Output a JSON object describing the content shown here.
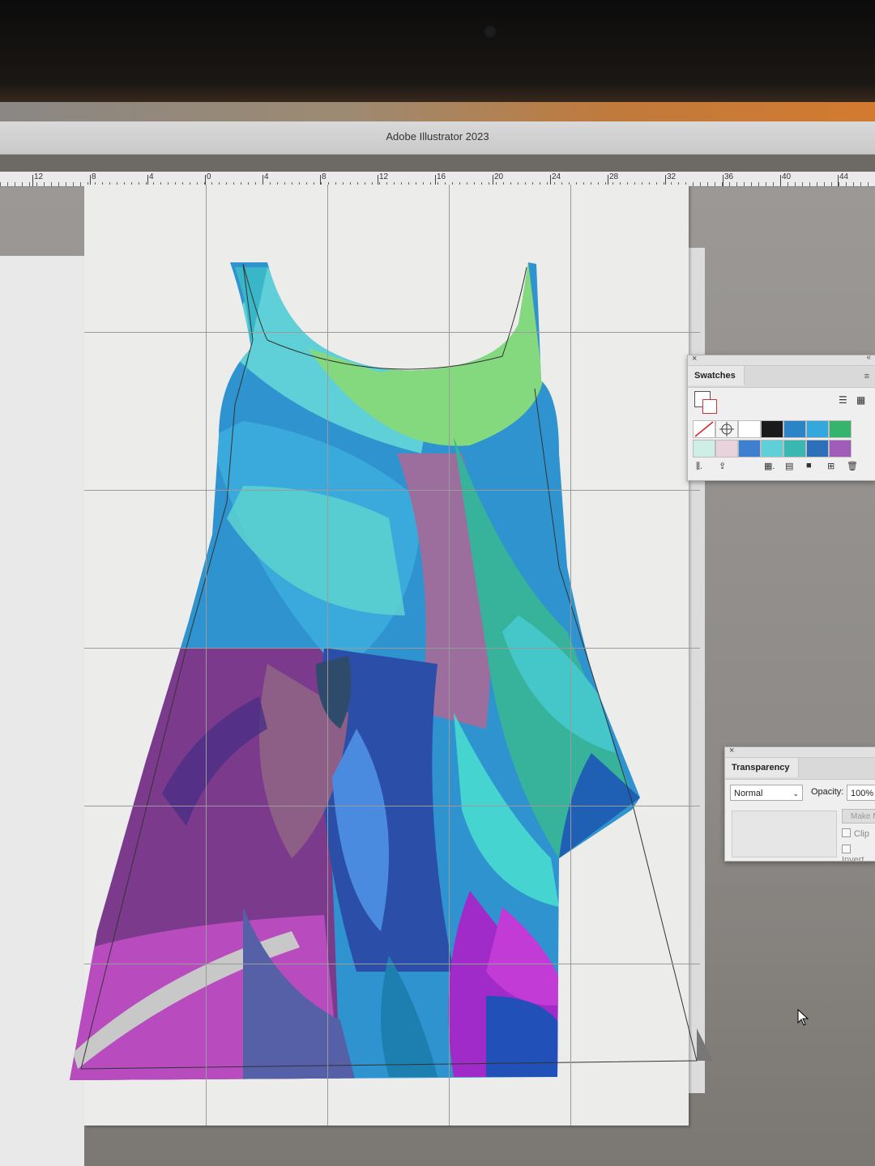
{
  "window": {
    "title": "Adobe Illustrator 2023"
  },
  "ruler": {
    "labels": [
      "12",
      "8",
      "4",
      "0",
      "4",
      "8",
      "12",
      "16",
      "20",
      "24",
      "28",
      "32",
      "36",
      "40",
      "44"
    ]
  },
  "panels": {
    "swatches": {
      "tab_label": "Swatches",
      "colors_row1": [
        "#ffffff",
        "#1a1a1a",
        "#2a84c6",
        "#34a8dc",
        "#36b36c"
      ],
      "colors_row2": [
        "#cfeee6",
        "#e8d3dc",
        "#3f7fd0",
        "#5fd0d8",
        "#3ab7b0",
        "#2d6fb8",
        "#a05cb8"
      ]
    },
    "transparency": {
      "tab_label": "Transparency",
      "blend_mode": "Normal",
      "opacity_label": "Opacity:",
      "opacity_value": "100%",
      "make_mask_label": "Make M",
      "clip_label": "Clip",
      "invert_label": "Invert"
    }
  },
  "colors": {
    "teal": "#45c6c8",
    "green": "#84d87e",
    "blue": "#2f93cf",
    "purple": "#7c3a8c",
    "magenta": "#c23bc8",
    "navy": "#2b4fa8"
  }
}
